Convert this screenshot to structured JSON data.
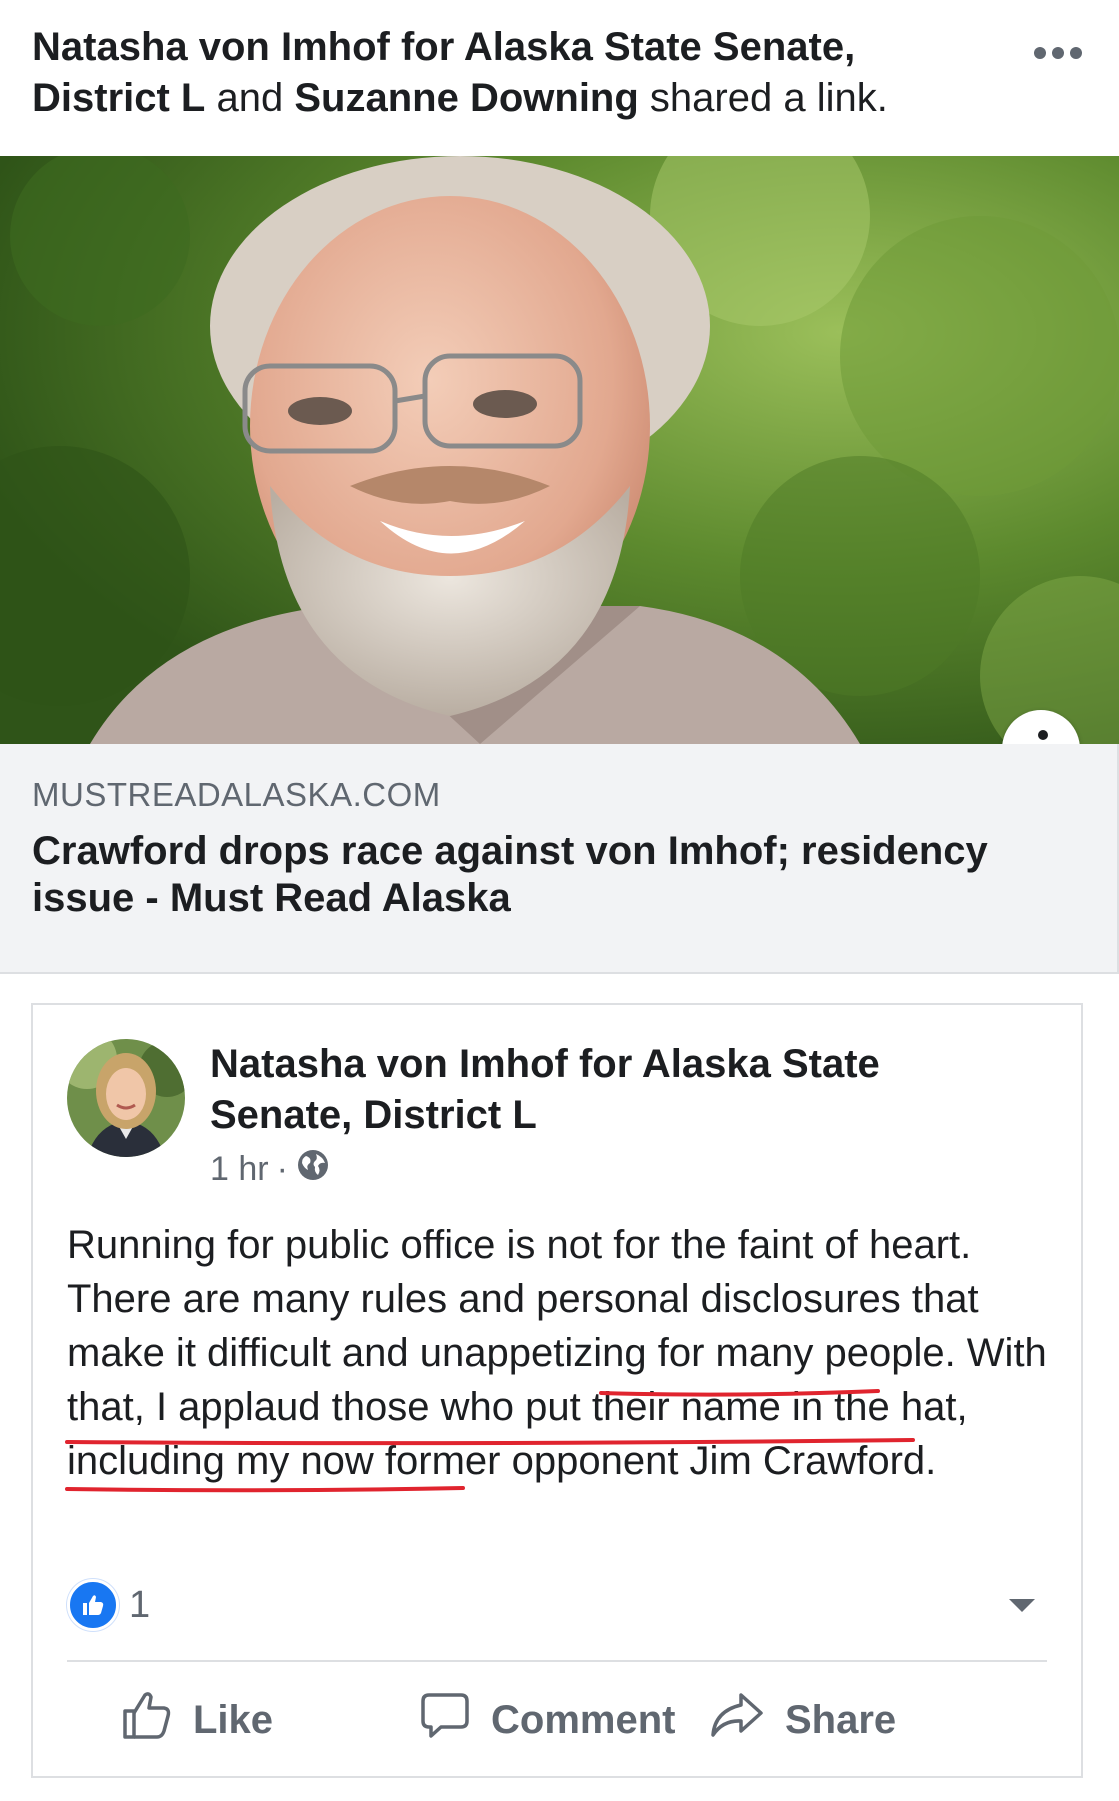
{
  "header": {
    "actor1": "Natasha von Imhof for Alaska State Senate, District L",
    "conj": "and",
    "actor2": "Suzanne Downing",
    "action": "shared a link."
  },
  "link": {
    "domain": "MUSTREADALASKA.COM",
    "title": "Crawford drops race against von Imhof; residency issue - Must Read Alaska"
  },
  "post": {
    "page_name": "Natasha von Imhof for Alaska State Senate, District L",
    "time": "1 hr",
    "separator": "·",
    "text_plain": "Running for public office is not for the faint of heart. There are many rules and personal disclosures that make it difficult and unappetizing for many people. With that, ",
    "text_underlined": "I applaud those who put their name in the hat, including my now former opponent Jim Crawford",
    "text_end": "."
  },
  "reactions": {
    "count": "1"
  },
  "actions": {
    "like": "Like",
    "comment": "Comment",
    "share": "Share"
  },
  "colors": {
    "underline": "#e0242e",
    "like_blue": "#1877f2",
    "grey_text": "#606770"
  },
  "icons": [
    "more-options-icon",
    "info-icon",
    "globe-icon",
    "like-reaction-icon",
    "caret-down-icon",
    "thumbs-up-icon",
    "comment-bubble-icon",
    "share-arrow-icon"
  ]
}
